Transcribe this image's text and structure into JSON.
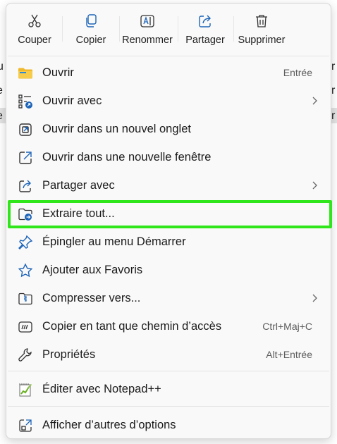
{
  "background": {
    "edge_right": [
      "r",
      "r",
      "r"
    ],
    "edge_left": [
      "u",
      "e",
      "e"
    ]
  },
  "toolbar": {
    "cut": "Couper",
    "copy": "Copier",
    "rename": "Renommer",
    "share": "Partager",
    "delete": "Supprimer"
  },
  "items": [
    {
      "label": "Ouvrir",
      "shortcut": "Entrée",
      "icon": "folder-icon"
    },
    {
      "label": "Ouvrir avec",
      "shortcut": "",
      "icon": "open-with-icon",
      "submenu": true
    },
    {
      "label": "Ouvrir dans un nouvel onglet",
      "shortcut": "",
      "icon": "new-tab-icon"
    },
    {
      "label": "Ouvrir dans une nouvelle fenêtre",
      "shortcut": "",
      "icon": "new-window-icon"
    },
    {
      "label": "Partager avec",
      "shortcut": "",
      "icon": "share-icon",
      "submenu": true
    },
    {
      "label": "Extraire tout...",
      "shortcut": "",
      "icon": "extract-folder-icon"
    },
    {
      "label": "Épingler au menu Démarrer",
      "shortcut": "",
      "icon": "pin-icon"
    },
    {
      "label": "Ajouter aux Favoris",
      "shortcut": "",
      "icon": "star-icon"
    },
    {
      "label": "Compresser vers...",
      "shortcut": "",
      "icon": "zip-icon",
      "submenu": true
    },
    {
      "label": "Copier en tant que chemin d’accès",
      "shortcut": "Ctrl+Maj+C",
      "icon": "copy-path-icon"
    },
    {
      "label": "Propriétés",
      "shortcut": "Alt+Entrée",
      "icon": "wrench-icon"
    }
  ],
  "notepad": {
    "label": "Éditer avec Notepad++",
    "icon": "notepad-icon"
  },
  "more": {
    "label": "Afficher d’autres d’options",
    "icon": "more-options-icon"
  },
  "colors": {
    "accent": "#0067c0",
    "highlight": "#2ee61a",
    "folder": "#f0b92b"
  }
}
